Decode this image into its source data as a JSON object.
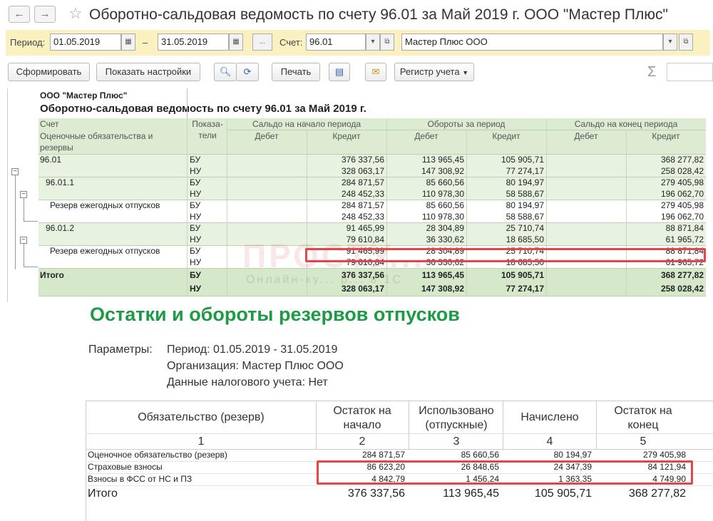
{
  "window": {
    "title": "Оборотно-сальдовая ведомость по счету 96.01 за Май 2019 г. ООО \"Мастер Плюс\""
  },
  "nav": {
    "back": "←",
    "forward": "→",
    "star": "☆"
  },
  "params": {
    "period_label": "Период:",
    "date_from": "01.05.2019",
    "dash": "–",
    "date_to": "31.05.2019",
    "ellipsis": "...",
    "account_label": "Счет:",
    "account": "96.01",
    "org": "Мастер Плюс ООО"
  },
  "toolbar": {
    "generate": "Сформировать",
    "show_settings": "Показать настройки",
    "print": "Печать",
    "registry": "Регистр учета",
    "sigma": "Σ"
  },
  "osv": {
    "org": "ООО \"Мастер Плюс\"",
    "title": "Оборотно-сальдовая ведомость по счету 96.01 за Май 2019 г.",
    "col_account": "Счет",
    "col_account_sub": "Оценочные обязательства и резервы",
    "col_ind": "Показа- тели",
    "col_start": "Сальдо на начало периода",
    "col_turn": "Обороты за период",
    "col_end": "Сальдо на конец периода",
    "debit": "Дебет",
    "credit": "Кредит",
    "rows": [
      {
        "name": "96.01",
        "ind": "БУ",
        "d1": "",
        "c1": "376 337,56",
        "d2": "113 965,45",
        "c2": "105 905,71",
        "d3": "",
        "c3": "368 277,82"
      },
      {
        "name": "",
        "ind": "НУ",
        "d1": "",
        "c1": "328 063,17",
        "d2": "147 308,92",
        "c2": "77 274,17",
        "d3": "",
        "c3": "258 028,42"
      },
      {
        "name": "96.01.1",
        "ind": "БУ",
        "d1": "",
        "c1": "284 871,57",
        "d2": "85 660,56",
        "c2": "80 194,97",
        "d3": "",
        "c3": "279 405,98"
      },
      {
        "name": "",
        "ind": "НУ",
        "d1": "",
        "c1": "248 452,33",
        "d2": "110 978,30",
        "c2": "58 588,67",
        "d3": "",
        "c3": "196 062,70"
      },
      {
        "name": "Резерв ежегодных отпусков",
        "ind": "БУ",
        "d1": "",
        "c1": "284 871,57",
        "d2": "85 660,56",
        "c2": "80 194,97",
        "d3": "",
        "c3": "279 405,98"
      },
      {
        "name": "",
        "ind": "НУ",
        "d1": "",
        "c1": "248 452,33",
        "d2": "110 978,30",
        "c2": "58 588,67",
        "d3": "",
        "c3": "196 062,70"
      },
      {
        "name": "96.01.2",
        "ind": "БУ",
        "d1": "",
        "c1": "91 465,99",
        "d2": "28 304,89",
        "c2": "25 710,74",
        "d3": "",
        "c3": "88 871,84"
      },
      {
        "name": "",
        "ind": "НУ",
        "d1": "",
        "c1": "79 610,84",
        "d2": "36 330,62",
        "c2": "18 685,50",
        "d3": "",
        "c3": "61 965,72"
      },
      {
        "name": "Резерв ежегодных отпусков",
        "ind": "БУ",
        "d1": "",
        "c1": "91 465,99",
        "d2": "28 304,89",
        "c2": "25 710,74",
        "d3": "",
        "c3": "88 871,84"
      },
      {
        "name": "",
        "ind": "НУ",
        "d1": "",
        "c1": "79 610,84",
        "d2": "36 330,62",
        "c2": "18 685,50",
        "d3": "",
        "c3": "61 965,72"
      },
      {
        "name": "Итого",
        "ind": "БУ",
        "d1": "",
        "c1": "376 337,56",
        "d2": "113 965,45",
        "c2": "105 905,71",
        "d3": "",
        "c3": "368 277,82"
      },
      {
        "name": "",
        "ind": "НУ",
        "d1": "",
        "c1": "328 063,17",
        "d2": "147 308,92",
        "c2": "77 274,17",
        "d3": "",
        "c3": "258 028,42"
      }
    ]
  },
  "watermark": {
    "brand": "ПРОСТУ...",
    "tagline": "Онлайн-ку... р... в 1С"
  },
  "report": {
    "title": "Остатки и обороты резервов отпусков",
    "params_label": "Параметры:",
    "period": "Период: 01.05.2019 - 31.05.2019",
    "org": "Организация: Мастер Плюс ООО",
    "tax": "Данные налогового учета: Нет",
    "headers": [
      "Обязательство (резерв)",
      "Остаток на начало",
      "Использовано (отпускные)",
      "Начислено",
      "Остаток на конец"
    ],
    "col_nums": [
      "1",
      "2",
      "3",
      "4",
      "5"
    ],
    "rows": [
      {
        "name": "Оценочное обязательство (резерв)",
        "v": [
          "284 871,57",
          "85 660,56",
          "80 194,97",
          "279 405,98"
        ]
      },
      {
        "name": "Страховые взносы",
        "v": [
          "86 623,20",
          "26 848,65",
          "24 347,39",
          "84 121,94"
        ]
      },
      {
        "name": "Взносы в ФСС от НС и ПЗ",
        "v": [
          "4 842,79",
          "1 456,24",
          "1 363,35",
          "4 749,90"
        ]
      }
    ],
    "total": {
      "name": "Итого",
      "v": [
        "376 337,56",
        "113 965,45",
        "105 905,71",
        "368 277,82"
      ]
    }
  },
  "colors": {
    "accent_green": "#1f9a44",
    "highlight_red": "#e34646",
    "param_bg": "#fbf0c0"
  }
}
